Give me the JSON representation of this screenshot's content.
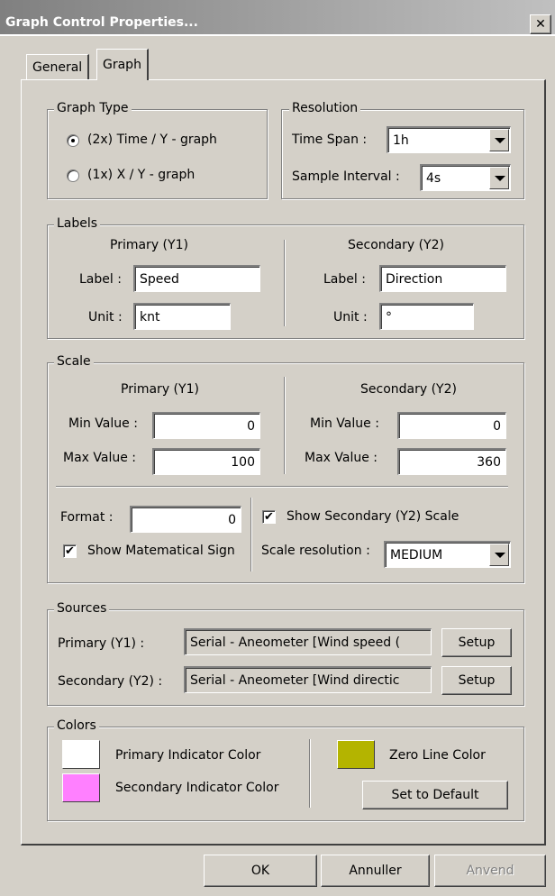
{
  "window": {
    "title": "Graph Control Properties...",
    "close_glyph": "✕"
  },
  "tabs": [
    {
      "label": "General"
    },
    {
      "label": "Graph"
    }
  ],
  "graph_type": {
    "title": "Graph Type",
    "options": [
      {
        "label": "(2x) Time / Y - graph",
        "selected": true
      },
      {
        "label": "(1x) X / Y - graph",
        "selected": false
      }
    ]
  },
  "resolution": {
    "title": "Resolution",
    "time_span_label": "Time Span :",
    "time_span_value": "1h",
    "sample_interval_label": "Sample Interval :",
    "sample_interval_value": "4s"
  },
  "labels": {
    "title": "Labels",
    "primary": {
      "heading": "Primary (Y1)",
      "label_label": "Label :",
      "label_value": "Speed",
      "unit_label": "Unit :",
      "unit_value": "knt"
    },
    "secondary": {
      "heading": "Secondary (Y2)",
      "label_label": "Label :",
      "label_value": "Direction",
      "unit_label": "Unit :",
      "unit_value": "°"
    }
  },
  "scale": {
    "title": "Scale",
    "primary": {
      "heading": "Primary (Y1)",
      "min_label": "Min Value :",
      "min_value": "0",
      "max_label": "Max Value :",
      "max_value": "100"
    },
    "secondary": {
      "heading": "Secondary (Y2)",
      "min_label": "Min Value :",
      "min_value": "0",
      "max_label": "Max Value :",
      "max_value": "360"
    },
    "format_label": "Format :",
    "format_value": "0",
    "show_sign_label": "Show Matematical Sign",
    "show_sign_checked": true,
    "show_secondary_label": "Show Secondary (Y2) Scale",
    "show_secondary_checked": true,
    "scale_resolution_label": "Scale resolution :",
    "scale_resolution_value": "MEDIUM",
    "check_glyph": "✔"
  },
  "sources": {
    "title": "Sources",
    "primary_label": "Primary (Y1) :",
    "primary_value": "Serial - Aneometer [Wind speed (",
    "secondary_label": "Secondary (Y2) :",
    "secondary_value": "Serial - Aneometer [Wind directic",
    "setup_label": "Setup"
  },
  "colors": {
    "title": "Colors",
    "primary_label": "Primary Indicator Color",
    "primary_color": "#ffffff",
    "secondary_label": "Secondary Indicator Color",
    "secondary_color": "#ff80ff",
    "zero_label": "Zero Line Color",
    "zero_color": "#b4b400",
    "default_label": "Set to Default"
  },
  "buttons": {
    "ok": "OK",
    "cancel": "Annuller",
    "apply": "Anvend"
  }
}
